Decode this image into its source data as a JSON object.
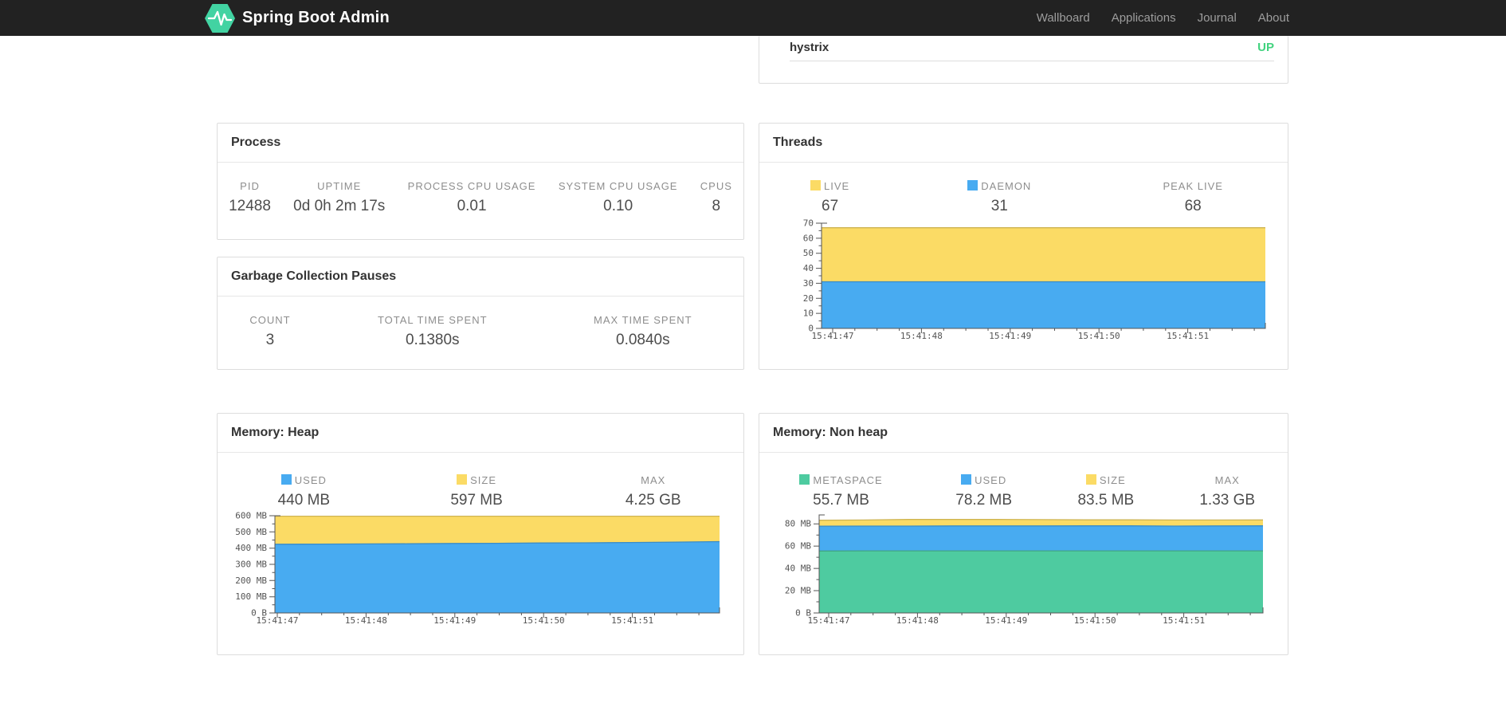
{
  "navbar": {
    "brand": "Spring Boot Admin",
    "items": [
      {
        "label": "Wallboard"
      },
      {
        "label": "Applications"
      },
      {
        "label": "Journal"
      },
      {
        "label": "About"
      }
    ]
  },
  "status_panel": {
    "application": "hystrix",
    "status": "UP",
    "status_color": "#42d37f"
  },
  "cards": {
    "process": {
      "title": "Process",
      "stats": [
        {
          "label": "PID",
          "value": "12488"
        },
        {
          "label": "UPTIME",
          "value": "0d 0h 2m 17s"
        },
        {
          "label": "PROCESS CPU USAGE",
          "value": "0.01"
        },
        {
          "label": "SYSTEM CPU USAGE",
          "value": "0.10"
        },
        {
          "label": "CPUS",
          "value": "8"
        }
      ]
    },
    "gc": {
      "title": "Garbage Collection Pauses",
      "stats": [
        {
          "label": "COUNT",
          "value": "3"
        },
        {
          "label": "TOTAL TIME SPENT",
          "value": "0.1380s"
        },
        {
          "label": "MAX TIME SPENT",
          "value": "0.0840s"
        }
      ]
    },
    "threads": {
      "title": "Threads",
      "stats": [
        {
          "label": "LIVE",
          "value": "67",
          "swatch": "#fbdb65"
        },
        {
          "label": "DAEMON",
          "value": "31",
          "swatch": "#48abf1"
        },
        {
          "label": "PEAK LIVE",
          "value": "68"
        }
      ]
    },
    "memory_heap": {
      "title": "Memory: Heap",
      "stats": [
        {
          "label": "USED",
          "value": "440 MB",
          "swatch": "#48abf1"
        },
        {
          "label": "SIZE",
          "value": "597 MB",
          "swatch": "#fbdb65"
        },
        {
          "label": "MAX",
          "value": "4.25 GB"
        }
      ]
    },
    "memory_nonheap": {
      "title": "Memory: Non heap",
      "stats": [
        {
          "label": "METASPACE",
          "value": "55.7 MB",
          "swatch": "#4ecba0"
        },
        {
          "label": "USED",
          "value": "78.2 MB",
          "swatch": "#48abf1"
        },
        {
          "label": "SIZE",
          "value": "83.5 MB",
          "swatch": "#fbdb65"
        },
        {
          "label": "MAX",
          "value": "1.33 GB"
        }
      ]
    }
  },
  "chart_data": [
    {
      "id": "threads",
      "type": "area",
      "title": "Threads",
      "x_labels": [
        "15:41:47",
        "15:41:48",
        "15:41:49",
        "15:41:50",
        "15:41:51"
      ],
      "ylim": [
        0,
        70
      ],
      "ydomain_max": 70,
      "grid": false,
      "legend_position": "top",
      "yticks": [
        {
          "v": 0,
          "label": "0"
        },
        {
          "v": 10,
          "label": "10"
        },
        {
          "v": 20,
          "label": "20"
        },
        {
          "v": 30,
          "label": "30"
        },
        {
          "v": 40,
          "label": "40"
        },
        {
          "v": 50,
          "label": "50"
        },
        {
          "v": 60,
          "label": "60"
        },
        {
          "v": 70,
          "label": "70"
        }
      ],
      "series": [
        {
          "name": "LIVE",
          "color": "#fbdb65",
          "values": [
            67,
            67,
            67,
            67,
            67,
            67,
            67,
            67,
            67,
            67,
            67
          ]
        },
        {
          "name": "DAEMON",
          "color": "#48abf1",
          "values": [
            31,
            31,
            31,
            31,
            31,
            31,
            31,
            31,
            31,
            31,
            31
          ]
        }
      ]
    },
    {
      "id": "heap",
      "type": "area",
      "title": "Memory: Heap (MB)",
      "x_labels": [
        "15:41:47",
        "15:41:48",
        "15:41:49",
        "15:41:50",
        "15:41:51"
      ],
      "ylim": [
        0,
        600
      ],
      "ydomain_max": 600,
      "grid": false,
      "legend_position": "top",
      "yticks": [
        {
          "v": 0,
          "label": "0 B"
        },
        {
          "v": 100,
          "label": "100 MB"
        },
        {
          "v": 200,
          "label": "200 MB"
        },
        {
          "v": 300,
          "label": "300 MB"
        },
        {
          "v": 400,
          "label": "400 MB"
        },
        {
          "v": 500,
          "label": "500 MB"
        },
        {
          "v": 600,
          "label": "600 MB"
        }
      ],
      "series": [
        {
          "name": "SIZE",
          "color": "#fbdb65",
          "values": [
            597,
            597,
            597,
            597,
            597,
            597,
            597,
            597,
            597,
            597,
            597
          ]
        },
        {
          "name": "USED",
          "color": "#48abf1",
          "values": [
            424,
            425,
            426,
            427,
            429,
            430,
            432,
            433,
            435,
            437,
            440
          ]
        }
      ]
    },
    {
      "id": "nonheap",
      "type": "area",
      "title": "Memory: Non heap (MB)",
      "x_labels": [
        "15:41:47",
        "15:41:48",
        "15:41:49",
        "15:41:50",
        "15:41:51"
      ],
      "ylim": [
        0,
        88
      ],
      "ydomain_max": 88,
      "grid": false,
      "legend_position": "top",
      "yticks": [
        {
          "v": 0,
          "label": "0 B"
        },
        {
          "v": 20,
          "label": "20 MB"
        },
        {
          "v": 40,
          "label": "40 MB"
        },
        {
          "v": 60,
          "label": "60 MB"
        },
        {
          "v": 80,
          "label": "80 MB"
        }
      ],
      "series": [
        {
          "name": "SIZE",
          "color": "#fbdb65",
          "values": [
            83.2,
            83.4,
            83.9,
            83.9,
            83.9,
            83.8,
            83.6,
            83.6,
            83.4,
            83.4,
            83.5
          ]
        },
        {
          "name": "USED",
          "color": "#48abf1",
          "values": [
            77.9,
            78.0,
            78.0,
            78.1,
            78.1,
            78.1,
            78.2,
            78.2,
            78.0,
            78.1,
            78.2
          ]
        },
        {
          "name": "METASPACE",
          "color": "#4ecba0",
          "values": [
            55.6,
            55.7,
            55.7,
            55.7,
            55.7,
            55.7,
            55.7,
            55.7,
            55.7,
            55.7,
            55.7
          ]
        }
      ]
    }
  ]
}
